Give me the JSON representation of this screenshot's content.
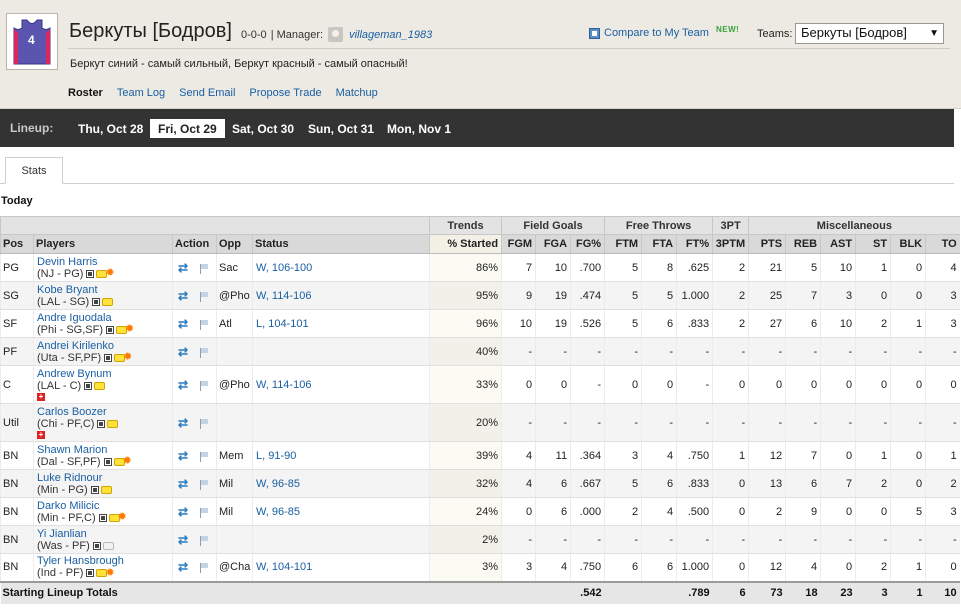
{
  "team": {
    "name": "Беркуты [Бодров]",
    "record": "0-0-0",
    "manager_label": "| Manager:",
    "manager_name": "villageman_1983",
    "motto": "Беркут синий - самый сильный, Беркут красный - самый опасный!",
    "jersey_number": "4"
  },
  "compare_link": "Compare to My Team",
  "new_badge": "NEW!",
  "teams_label": "Teams:",
  "teams_selected": "Беркуты [Бодров]",
  "nav": [
    "Roster",
    "Team Log",
    "Send Email",
    "Propose Trade",
    "Matchup"
  ],
  "lineup": {
    "label": "Lineup:",
    "dates": [
      "Thu, Oct 28",
      "Fri, Oct 29",
      "Sat, Oct 30",
      "Sun, Oct 31",
      "Mon, Nov 1"
    ],
    "active_index": 1
  },
  "tab": "Stats",
  "section_title": "Today",
  "table": {
    "group_headers": {
      "trends": "Trends",
      "field_goals": "Field Goals",
      "free_throws": "Free Throws",
      "three_pt": "3PT",
      "misc": "Miscellaneous"
    },
    "columns": [
      "Pos",
      "Players",
      "Action",
      "Opp",
      "Status",
      "% Started",
      "FGM",
      "FGA",
      "FG%",
      "FTM",
      "FTA",
      "FT%",
      "3PTM",
      "PTS",
      "REB",
      "AST",
      "ST",
      "BLK",
      "TO"
    ],
    "rows": [
      {
        "pos": "PG",
        "name": "Devin Harris",
        "team": "(NJ - PG)",
        "opp": "Sac",
        "status": "W, 106-100",
        "started": "86%",
        "fgm": "7",
        "fga": "10",
        "fgp": ".700",
        "ftm": "5",
        "fta": "8",
        "ftp": ".625",
        "tpm": "2",
        "pts": "21",
        "reb": "5",
        "ast": "10",
        "st": "1",
        "blk": "0",
        "to": "4"
      },
      {
        "pos": "SG",
        "name": "Kobe Bryant",
        "team": "(LAL - SG)",
        "opp": "@Pho",
        "status": "W, 114-106",
        "started": "95%",
        "fgm": "9",
        "fga": "19",
        "fgp": ".474",
        "ftm": "5",
        "fta": "5",
        "ftp": "1.000",
        "tpm": "2",
        "pts": "25",
        "reb": "7",
        "ast": "3",
        "st": "0",
        "blk": "0",
        "to": "3"
      },
      {
        "pos": "SF",
        "name": "Andre Iguodala",
        "team": "(Phi - SG,SF)",
        "opp": "Atl",
        "status": "L, 104-101",
        "started": "96%",
        "fgm": "10",
        "fga": "19",
        "fgp": ".526",
        "ftm": "5",
        "fta": "6",
        "ftp": ".833",
        "tpm": "2",
        "pts": "27",
        "reb": "6",
        "ast": "10",
        "st": "2",
        "blk": "1",
        "to": "3"
      },
      {
        "pos": "PF",
        "name": "Andrei Kirilenko",
        "team": "(Uta - SF,PF)",
        "opp": "",
        "status": "",
        "started": "40%",
        "fgm": "-",
        "fga": "-",
        "fgp": "-",
        "ftm": "-",
        "fta": "-",
        "ftp": "-",
        "tpm": "-",
        "pts": "-",
        "reb": "-",
        "ast": "-",
        "st": "-",
        "blk": "-",
        "to": "-"
      },
      {
        "pos": "C",
        "name": "Andrew Bynum",
        "team": "(LAL - C)",
        "opp": "@Pho",
        "status": "W, 114-106",
        "started": "33%",
        "fgm": "0",
        "fga": "0",
        "fgp": "-",
        "ftm": "0",
        "fta": "0",
        "ftp": "-",
        "tpm": "0",
        "pts": "0",
        "reb": "0",
        "ast": "0",
        "st": "0",
        "blk": "0",
        "to": "0"
      },
      {
        "pos": "Util",
        "name": "Carlos Boozer",
        "team": "(Chi - PF,C)",
        "opp": "",
        "status": "",
        "started": "20%",
        "fgm": "-",
        "fga": "-",
        "fgp": "-",
        "ftm": "-",
        "fta": "-",
        "ftp": "-",
        "tpm": "-",
        "pts": "-",
        "reb": "-",
        "ast": "-",
        "st": "-",
        "blk": "-",
        "to": "-"
      },
      {
        "pos": "BN",
        "name": "Shawn Marion",
        "team": "(Dal - SF,PF)",
        "opp": "Mem",
        "status": "L, 91-90",
        "started": "39%",
        "fgm": "4",
        "fga": "11",
        "fgp": ".364",
        "ftm": "3",
        "fta": "4",
        "ftp": ".750",
        "tpm": "1",
        "pts": "12",
        "reb": "7",
        "ast": "0",
        "st": "1",
        "blk": "0",
        "to": "1"
      },
      {
        "pos": "BN",
        "name": "Luke Ridnour",
        "team": "(Min - PG)",
        "opp": "Mil",
        "status": "W, 96-85",
        "started": "32%",
        "fgm": "4",
        "fga": "6",
        "fgp": ".667",
        "ftm": "5",
        "fta": "6",
        "ftp": ".833",
        "tpm": "0",
        "pts": "13",
        "reb": "6",
        "ast": "7",
        "st": "2",
        "blk": "0",
        "to": "2"
      },
      {
        "pos": "BN",
        "name": "Darko Milicic",
        "team": "(Min - PF,C)",
        "opp": "Mil",
        "status": "W, 96-85",
        "started": "24%",
        "fgm": "0",
        "fga": "6",
        "fgp": ".000",
        "ftm": "2",
        "fta": "4",
        "ftp": ".500",
        "tpm": "0",
        "pts": "2",
        "reb": "9",
        "ast": "0",
        "st": "0",
        "blk": "5",
        "to": "3"
      },
      {
        "pos": "BN",
        "name": "Yi Jianlian",
        "team": "(Was - PF)",
        "opp": "",
        "status": "",
        "started": "2%",
        "fgm": "-",
        "fga": "-",
        "fgp": "-",
        "ftm": "-",
        "fta": "-",
        "ftp": "-",
        "tpm": "-",
        "pts": "-",
        "reb": "-",
        "ast": "-",
        "st": "-",
        "blk": "-",
        "to": "-"
      },
      {
        "pos": "BN",
        "name": "Tyler Hansbrough",
        "team": "(Ind - PF)",
        "opp": "@Cha",
        "status": "W, 104-101",
        "started": "3%",
        "fgm": "3",
        "fga": "4",
        "fgp": ".750",
        "ftm": "6",
        "fta": "6",
        "ftp": "1.000",
        "tpm": "0",
        "pts": "12",
        "reb": "4",
        "ast": "0",
        "st": "2",
        "blk": "1",
        "to": "0"
      }
    ],
    "totals": {
      "label": "Starting Lineup Totals",
      "fgp": ".542",
      "ftp": ".789",
      "tpm": "6",
      "pts": "73",
      "reb": "18",
      "ast": "23",
      "st": "3",
      "blk": "1",
      "to": "10"
    }
  },
  "colors": {
    "accent_link": "#1a5fa3",
    "lineup_bar": "#333333",
    "header_bg": "#eceae2",
    "jersey": "#5b55b0"
  },
  "icons": [
    "jersey-icon",
    "avatar-icon",
    "compare-icon",
    "note-icon",
    "news-icon",
    "hot-icon",
    "injury-icon",
    "move-player-icon",
    "flag-icon",
    "dropdown-arrow-icon"
  ]
}
